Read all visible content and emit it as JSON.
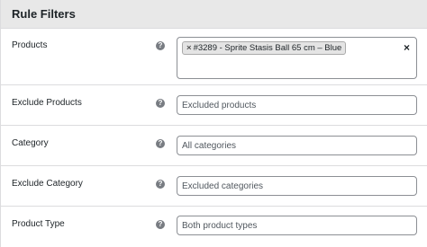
{
  "panel": {
    "title": "Rule Filters"
  },
  "help_icon": {
    "glyph": "?"
  },
  "rows": [
    {
      "label": "Products",
      "token_remove": "×",
      "token_text": "#3289 - Sprite Stasis Ball 65 cm – Blue",
      "clear_glyph": "×"
    },
    {
      "label": "Exclude Products",
      "placeholder": "Excluded products"
    },
    {
      "label": "Category",
      "placeholder": "All categories"
    },
    {
      "label": "Exclude Category",
      "placeholder": "Excluded categories"
    },
    {
      "label": "Product Type",
      "placeholder": "Both product types"
    }
  ],
  "colors": {
    "header_bg": "#e8e8e8",
    "border": "#dcdcde",
    "help_bg": "#787c82",
    "token_bg": "#e4e4e4"
  }
}
